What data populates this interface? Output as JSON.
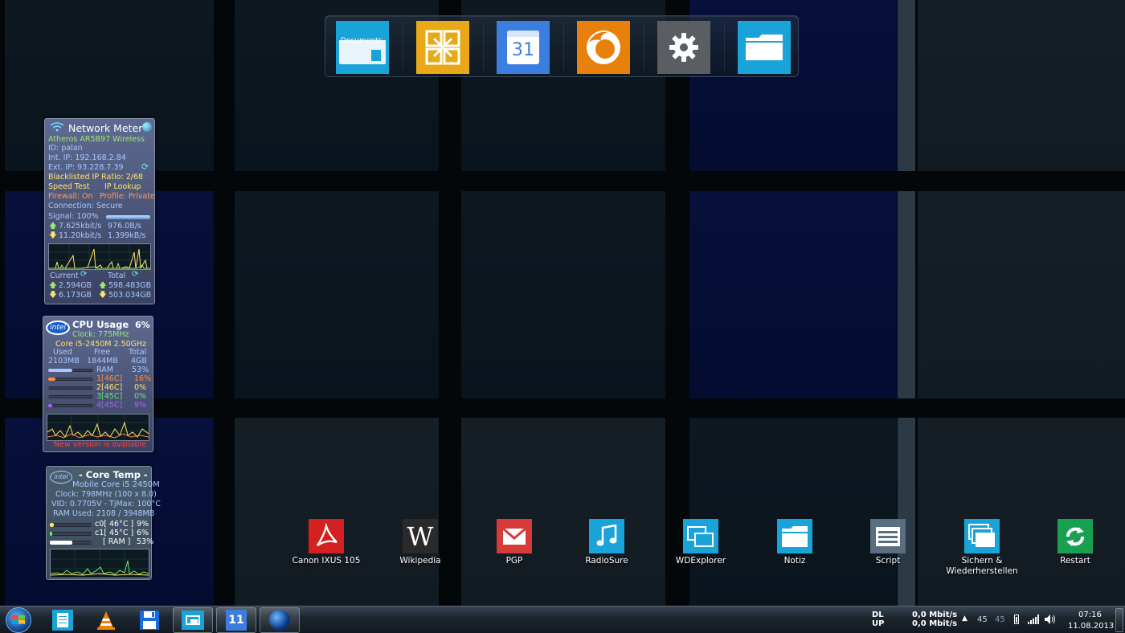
{
  "dock": {
    "items": [
      {
        "name": "documents",
        "label": "Documents"
      },
      {
        "name": "office"
      },
      {
        "name": "calendar",
        "label": "31"
      },
      {
        "name": "firefox"
      },
      {
        "name": "settings"
      },
      {
        "name": "folder"
      }
    ]
  },
  "network_meter": {
    "title": "Network Meter",
    "adapter": "Atheros AR5B97 Wireless",
    "id": "ID: palan",
    "int_ip": "Int. IP: 192.168.2.84",
    "ext_ip": "Ext. IP: 93.228.7.39",
    "blacklist": "Blacklisted IP Ratio: 2/68",
    "speed_test": "Speed Test",
    "ip_lookup": "IP Lookup",
    "firewall": "Firewall: On",
    "profile": "Profile: Private",
    "connection": "Connection: Secure",
    "signal": "Signal: 100%",
    "signal_level": 1.0,
    "up_rate": "7.625kbit/s",
    "up_bytes": "976.0B/s",
    "down_rate": "11.20kbit/s",
    "down_bytes": "1.399kB/s",
    "current_label": "Current",
    "total_label": "Total",
    "current_up": "2.594GB",
    "current_down": "6.173GB",
    "total_up": "598.483GB",
    "total_down": "503.034GB"
  },
  "cpu_usage": {
    "logo": "intel",
    "title": "CPU Usage",
    "percent": "6%",
    "clock": "Clock:  775MHz",
    "model": "Core i5-2450M 2.50GHz",
    "headers": [
      "Used",
      "Free",
      "Total"
    ],
    "values": [
      "2103MB",
      "1844MB",
      "4GB"
    ],
    "ram_label": "RAM",
    "ram_percent": "53%",
    "ram_level": 0.53,
    "cores": [
      {
        "label": "1[46C]",
        "percent": "16%",
        "level": 0.16,
        "color": "#ff8c40"
      },
      {
        "label": "2[46C]",
        "percent": "0%",
        "level": 0.0,
        "color": "#ffe46a"
      },
      {
        "label": "3[45C]",
        "percent": "0%",
        "level": 0.0,
        "color": "#70e870"
      },
      {
        "label": "4[45C]",
        "percent": "9%",
        "level": 0.09,
        "color": "#b060ff"
      }
    ],
    "notice": "New version is available"
  },
  "core_temp": {
    "logo": "intel",
    "title": "- Core Temp -",
    "model": "Mobile Core i5 2450M",
    "clock": "Clock: 798MHz (100 x 8.0)",
    "vid": "VID: 0.7705V - TjMax: 100°C",
    "ram_used": "RAM Used: 2108 / 3948MB",
    "rows": [
      {
        "label": "c0[ 46°C ]",
        "percent": "9%",
        "level": 0.09,
        "color": "#ffe46a"
      },
      {
        "label": "c1[ 45°C ]",
        "percent": "6%",
        "level": 0.06,
        "color": "#70e870"
      },
      {
        "label": "[ RAM ]",
        "percent": "53%",
        "level": 0.53,
        "color": "#ffffff"
      }
    ]
  },
  "desktop_icons": [
    {
      "name": "canon",
      "label": "Canon IXUS 105",
      "icon": "pdf-icon",
      "color": "#d42020"
    },
    {
      "name": "wikipedia",
      "label": "Wikipedia",
      "icon": "wikipedia-icon",
      "color": "#2a2a2a"
    },
    {
      "name": "pgp",
      "label": "PGP",
      "icon": "mail-icon",
      "color": "#d83a3a"
    },
    {
      "name": "radiosure",
      "label": "RadioSure",
      "icon": "music-icon",
      "color": "#1aa3d8"
    },
    {
      "name": "wdexplorer",
      "label": "WDExplorer",
      "icon": "windows-icon",
      "color": "#1aa3d8"
    },
    {
      "name": "notiz",
      "label": "Notiz",
      "icon": "folder-icon",
      "color": "#1aa3d8"
    },
    {
      "name": "script",
      "label": "Script",
      "icon": "script-icon",
      "color": "#5a6e82"
    },
    {
      "name": "sichern",
      "label": "Sichern &\nWiederherstellen",
      "icon": "backup-icon",
      "color": "#1aa3d8"
    },
    {
      "name": "restart",
      "label": "Restart",
      "icon": "restart-icon",
      "color": "#18a050"
    }
  ],
  "taskbar": {
    "items": [
      "start",
      "notepad",
      "vlc",
      "save",
      "explorer",
      "calendar",
      "globe"
    ],
    "calendar_day": "11",
    "dl_label": "DL",
    "up_label": "UP",
    "dl_speed": "0,0 Mbit/s",
    "up_speed": "0,0 Mbit/s",
    "temp1": "45",
    "temp2": "45",
    "time": "07:16",
    "date": "11.08.2013"
  }
}
